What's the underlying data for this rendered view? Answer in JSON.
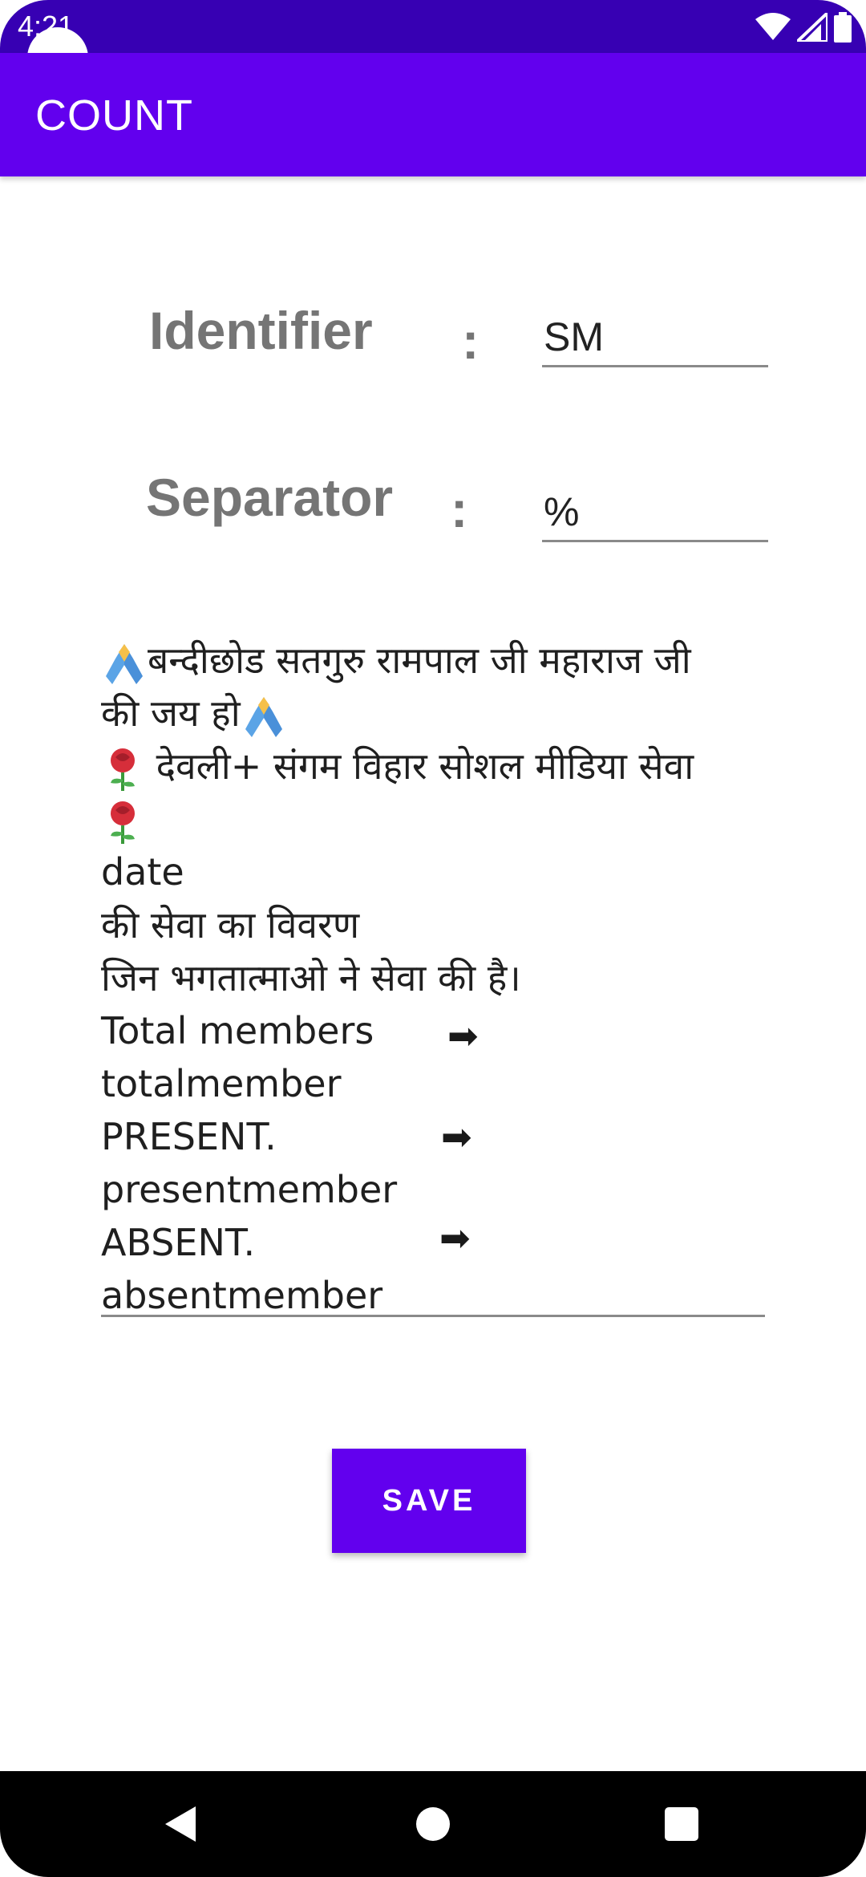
{
  "status_bar": {
    "time": "4:21",
    "icons": [
      "wifi-icon",
      "signal-icon",
      "battery-icon"
    ]
  },
  "app_bar": {
    "title": "COUNT"
  },
  "form": {
    "identifier": {
      "label": "Identifier",
      "colon": ":",
      "value": "SM"
    },
    "separator": {
      "label": "Separator",
      "colon": ":",
      "value": "%"
    }
  },
  "message": {
    "line1_text": "बन्दीछोड सतगुरु रामपाल जी महाराज जी",
    "line2_text": "की जय हो",
    "line3_text": " देवली+ संगम विहार सोशल मीडिया सेवा",
    "line5": "date",
    "line6": "की सेवा का विवरण",
    "line7": "जिन भगतात्माओ ने सेवा की है।",
    "line8": "Total members",
    "line9": "totalmember",
    "line10": "PRESENT.",
    "line11": "presentmember",
    "line12": "ABSENT.",
    "line13": "absentmember",
    "arrow": "➡",
    "emoji_pray": "folded-hands-icon",
    "emoji_rose": "rose-icon"
  },
  "save_button": {
    "label": "SAVE"
  },
  "nav_bar": {
    "back": "back-icon",
    "home": "home-icon",
    "recents": "recents-icon"
  },
  "colors": {
    "status_bar": "#3700b3",
    "primary": "#6200ee",
    "label_gray": "#757575"
  }
}
